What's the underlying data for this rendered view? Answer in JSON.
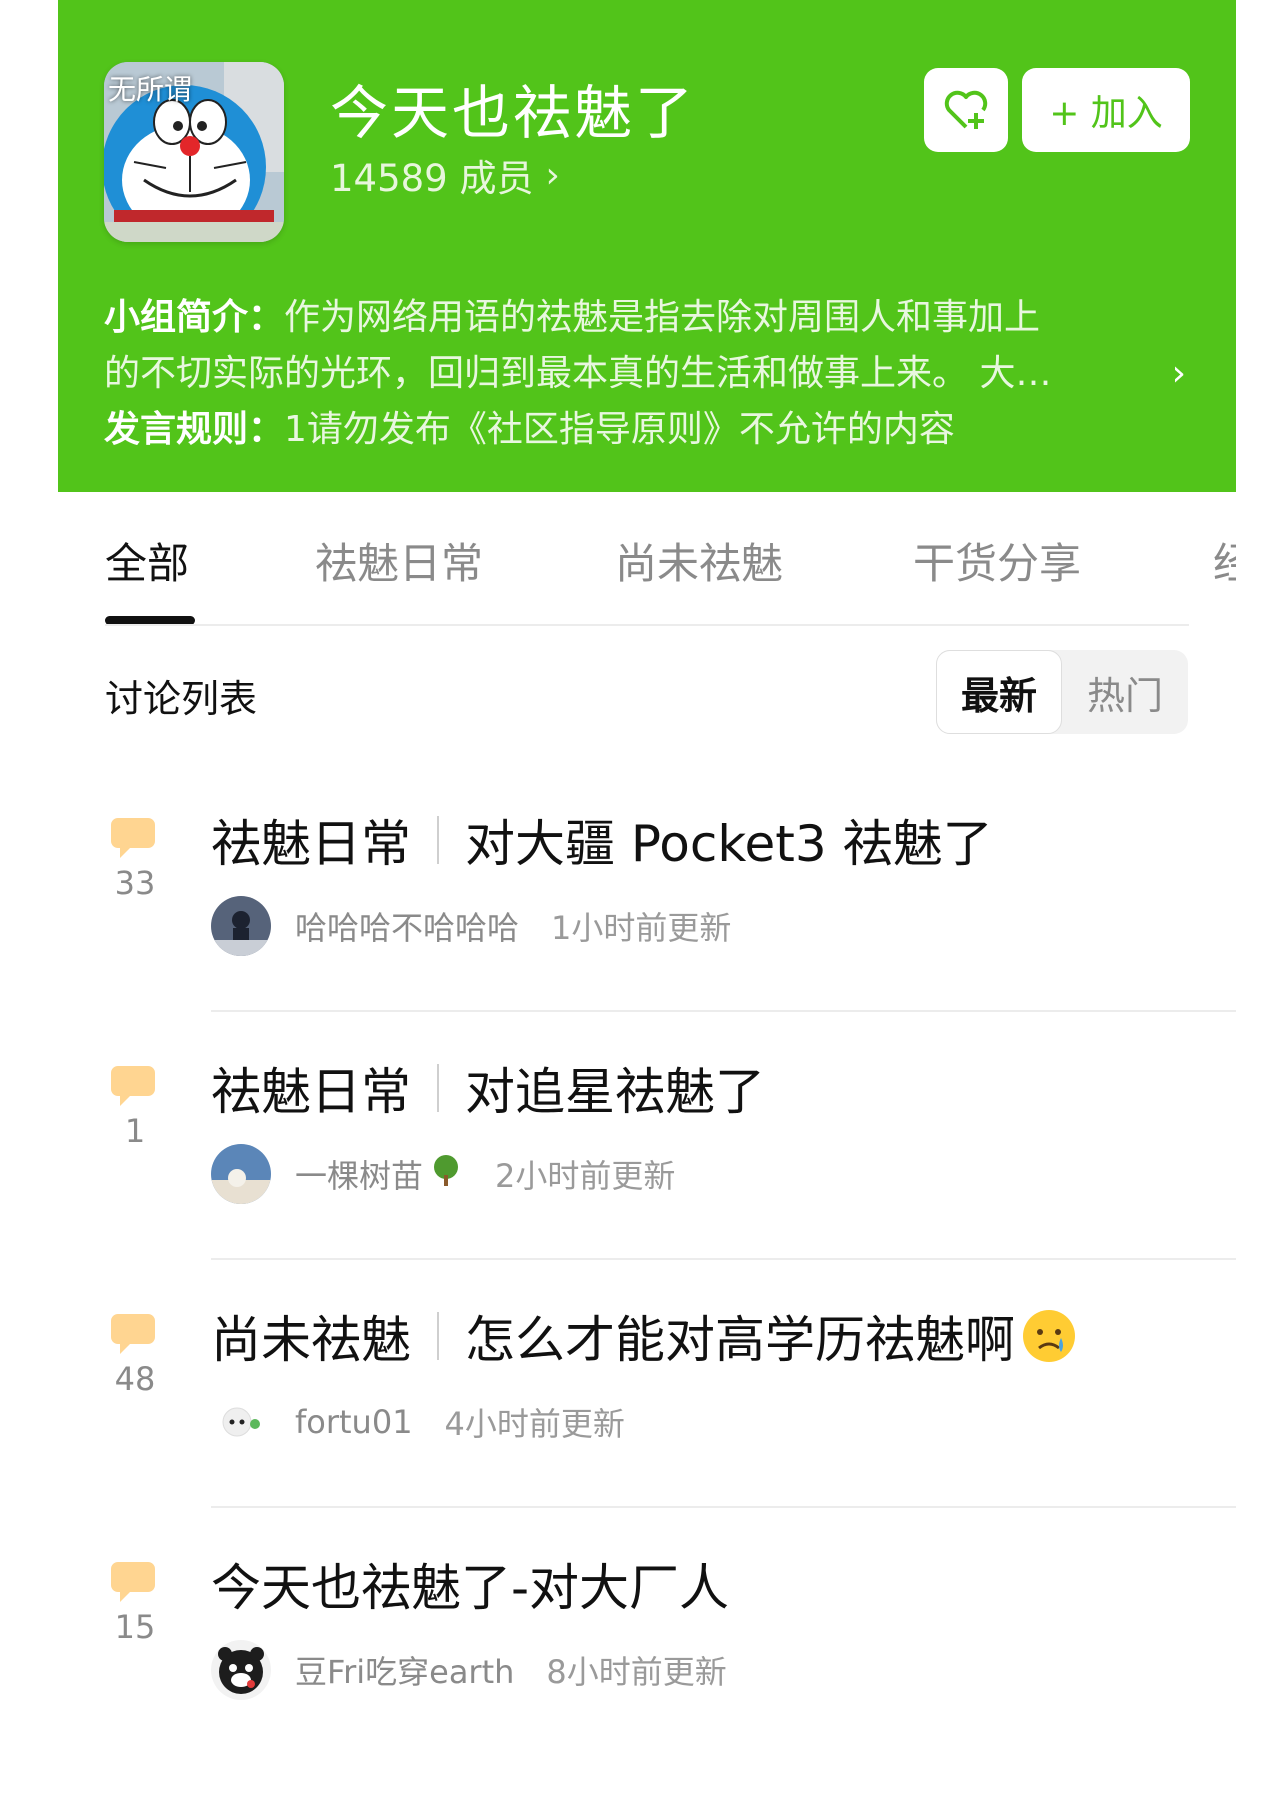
{
  "group": {
    "avatar_caption": "无所谓",
    "title": "今天也祛魅了",
    "members": "14589 成员",
    "join_label": "+ 加入",
    "intro_label": "小组简介：",
    "intro_line1": "作为网络用语的祛魅是指去除对周围人和事加上",
    "intro_line2": "的不切实际的光环，回归到最本真的生活和做事上来。 大…",
    "rules_label": "发言规则：",
    "rules_text": "1请勿发布《社区指导原则》不允许的内容"
  },
  "tabs": [
    "全部",
    "祛魅日常",
    "尚未祛魅",
    "干货分享",
    "经"
  ],
  "list": {
    "title": "讨论列表",
    "sort_newest": "最新",
    "sort_hot": "热门"
  },
  "posts": [
    {
      "tag": "祛魅日常",
      "title": "对大疆 Pocket3 祛魅了",
      "count": "33",
      "author": "哈哈哈不哈哈哈",
      "time": "1小时前更新"
    },
    {
      "tag": "祛魅日常",
      "title": "对追星祛魅了",
      "count": "1",
      "author": "一棵树苗",
      "time": "2小时前更新"
    },
    {
      "tag": "尚未祛魅",
      "title": "怎么才能对高学历祛魅啊",
      "count": "48",
      "author": "fortu01",
      "time": "4小时前更新"
    },
    {
      "tag": "",
      "title": "今天也祛魅了-对大厂人",
      "count": "15",
      "author": "豆Fri吃穿earth",
      "time": "8小时前更新"
    }
  ],
  "colors": {
    "brand_green": "#52c41a",
    "bubble": "#ffd591",
    "muted": "#8a8a8a"
  }
}
